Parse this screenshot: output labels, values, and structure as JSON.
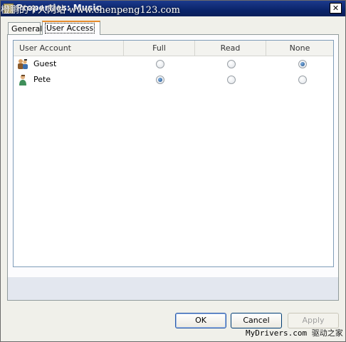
{
  "titlebar": {
    "title": "Properties: Music",
    "watermark": "橙鹏的个人网站 www.chenpeng123.com",
    "close_glyph": "✕"
  },
  "tabs": [
    {
      "label": "General"
    },
    {
      "label": "User Access",
      "active": true
    }
  ],
  "table": {
    "columns": [
      "User Account",
      "Full",
      "Read",
      "None"
    ],
    "rows": [
      {
        "name": "Guest",
        "icon": "guest-users-icon",
        "selected": "None"
      },
      {
        "name": "Pete",
        "icon": "user-icon",
        "selected": "Full"
      }
    ]
  },
  "buttons": {
    "ok": "OK",
    "cancel": "Cancel",
    "apply": "Apply"
  },
  "footer": {
    "site": "MyDrivers.com",
    "cn": "驱动之家"
  },
  "colors": {
    "titlebar": "#0a246a",
    "active_tab_accent": "#e68b2c",
    "radio_checked": "#1e4f8a"
  }
}
